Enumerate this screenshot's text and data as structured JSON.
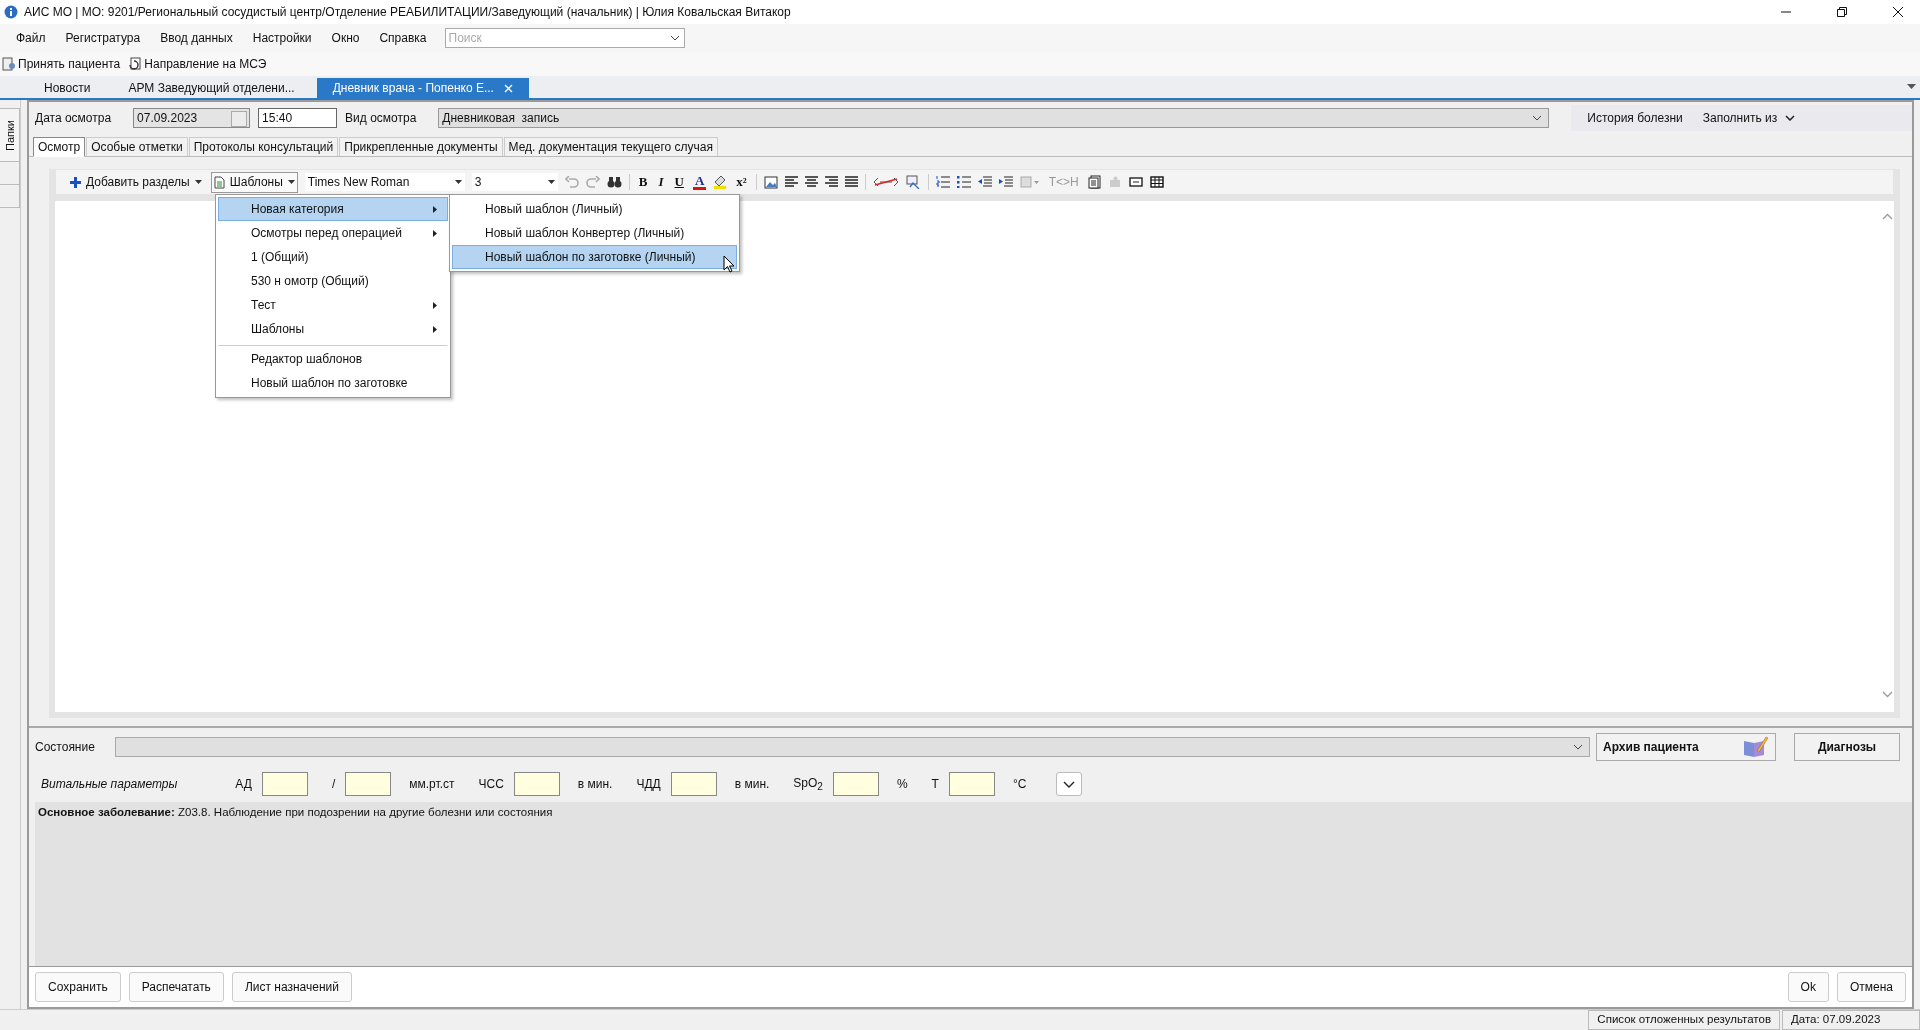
{
  "window": {
    "title": "АИС МО | МО: 9201/Региональный сосудистый центр/Отделение РЕАБИЛИТАЦИИ/Заведующий (начальник) | Юлия Ковальская Витакор"
  },
  "menu": [
    "Файл",
    "Регистратура",
    "Ввод данных",
    "Настройки",
    "Окно",
    "Справка"
  ],
  "search": {
    "placeholder": "Поиск"
  },
  "toolbar": [
    "Принять пациента",
    "Направление на МСЭ"
  ],
  "tabs": [
    {
      "label": "Новости",
      "selected": false,
      "closable": false
    },
    {
      "label": "АРМ Заведующий отделени...",
      "selected": false,
      "closable": false
    },
    {
      "label": "Дневник врача - Попенко Е...",
      "selected": true,
      "closable": true
    }
  ],
  "side_panel": {
    "label": "Папки"
  },
  "form": {
    "date_label": "Дата осмотра",
    "date": "07.09.2023",
    "time": "15:40",
    "type_label": "Вид осмотра",
    "type": "Дневниковая  запись",
    "history": "История болезни",
    "fill_from": "Заполнить из"
  },
  "subtabs": [
    {
      "label": "Осмотр",
      "selected": true
    },
    {
      "label": "Особые отметки",
      "selected": false
    },
    {
      "label": "Протоколы консультаций",
      "selected": false
    },
    {
      "label": "Прикрепленные документы",
      "selected": false
    },
    {
      "label": "Мед. документация текущего случая",
      "selected": false
    }
  ],
  "editor": {
    "add_sections": "Добавить разделы",
    "templates": "Шаблоны",
    "font": "Times New Roman",
    "size": "3",
    "format": [
      "B",
      "I",
      "U",
      "A",
      "x²",
      "T<>H"
    ]
  },
  "templates_menu": [
    {
      "label": "Новая категория",
      "submenu": true,
      "selected": true,
      "separator_before": false
    },
    {
      "label": "Осмотры перед операцией",
      "submenu": true,
      "selected": false,
      "separator_before": false
    },
    {
      "label": "1 (Общий)",
      "submenu": false,
      "selected": false,
      "separator_before": false
    },
    {
      "label": "530 н омотр (Общий)",
      "submenu": false,
      "selected": false,
      "separator_before": false
    },
    {
      "label": "Тест",
      "submenu": true,
      "selected": false,
      "separator_before": false
    },
    {
      "label": "Шаблоны",
      "submenu": true,
      "selected": false,
      "separator_before": false
    },
    {
      "label": "Редактор шаблонов",
      "submenu": false,
      "selected": false,
      "separator_before": true
    },
    {
      "label": "Новый шаблон по заготовке",
      "submenu": false,
      "selected": false,
      "separator_before": false
    }
  ],
  "submenu": [
    {
      "label": "Новый шаблон (Личный)",
      "selected": false
    },
    {
      "label": "Новый шаблон Конвертер (Личный)",
      "selected": false
    },
    {
      "label": "Новый шаблон по заготовке (Личный)",
      "selected": true
    }
  ],
  "state": {
    "label": "Состояние",
    "archive": "Архив пациента",
    "diagnoses": "Диагнозы"
  },
  "vitals": {
    "title": "Витальные параметры",
    "items": [
      {
        "kind": "label",
        "text": "АД"
      },
      {
        "kind": "field"
      },
      {
        "kind": "label",
        "text": "/"
      },
      {
        "kind": "field"
      },
      {
        "kind": "unit",
        "text": "мм.рт.ст"
      },
      {
        "kind": "label",
        "text": "ЧСС"
      },
      {
        "kind": "field"
      },
      {
        "kind": "unit",
        "text": "в мин."
      },
      {
        "kind": "label",
        "text": "ЧДД"
      },
      {
        "kind": "field"
      },
      {
        "kind": "unit",
        "text": "в мин."
      },
      {
        "kind": "label",
        "text": "SpO$_{2}$"
      },
      {
        "kind": "field"
      },
      {
        "kind": "unit",
        "text": "%"
      },
      {
        "kind": "label",
        "text": "Т"
      },
      {
        "kind": "field"
      },
      {
        "kind": "unit",
        "text": "°C"
      }
    ]
  },
  "diagnosis": "**Основное заболевание:** Z03.8. Наблюдение при подозрении на другие болезни или состояния",
  "buttons_left": [
    "Сохранить",
    "Распечатать",
    "Лист назначений"
  ],
  "buttons_right": [
    "Ok",
    "Отмена"
  ],
  "status_bar": [
    "Список отложенных результатов",
    "Дата: 07.09.2023"
  ]
}
